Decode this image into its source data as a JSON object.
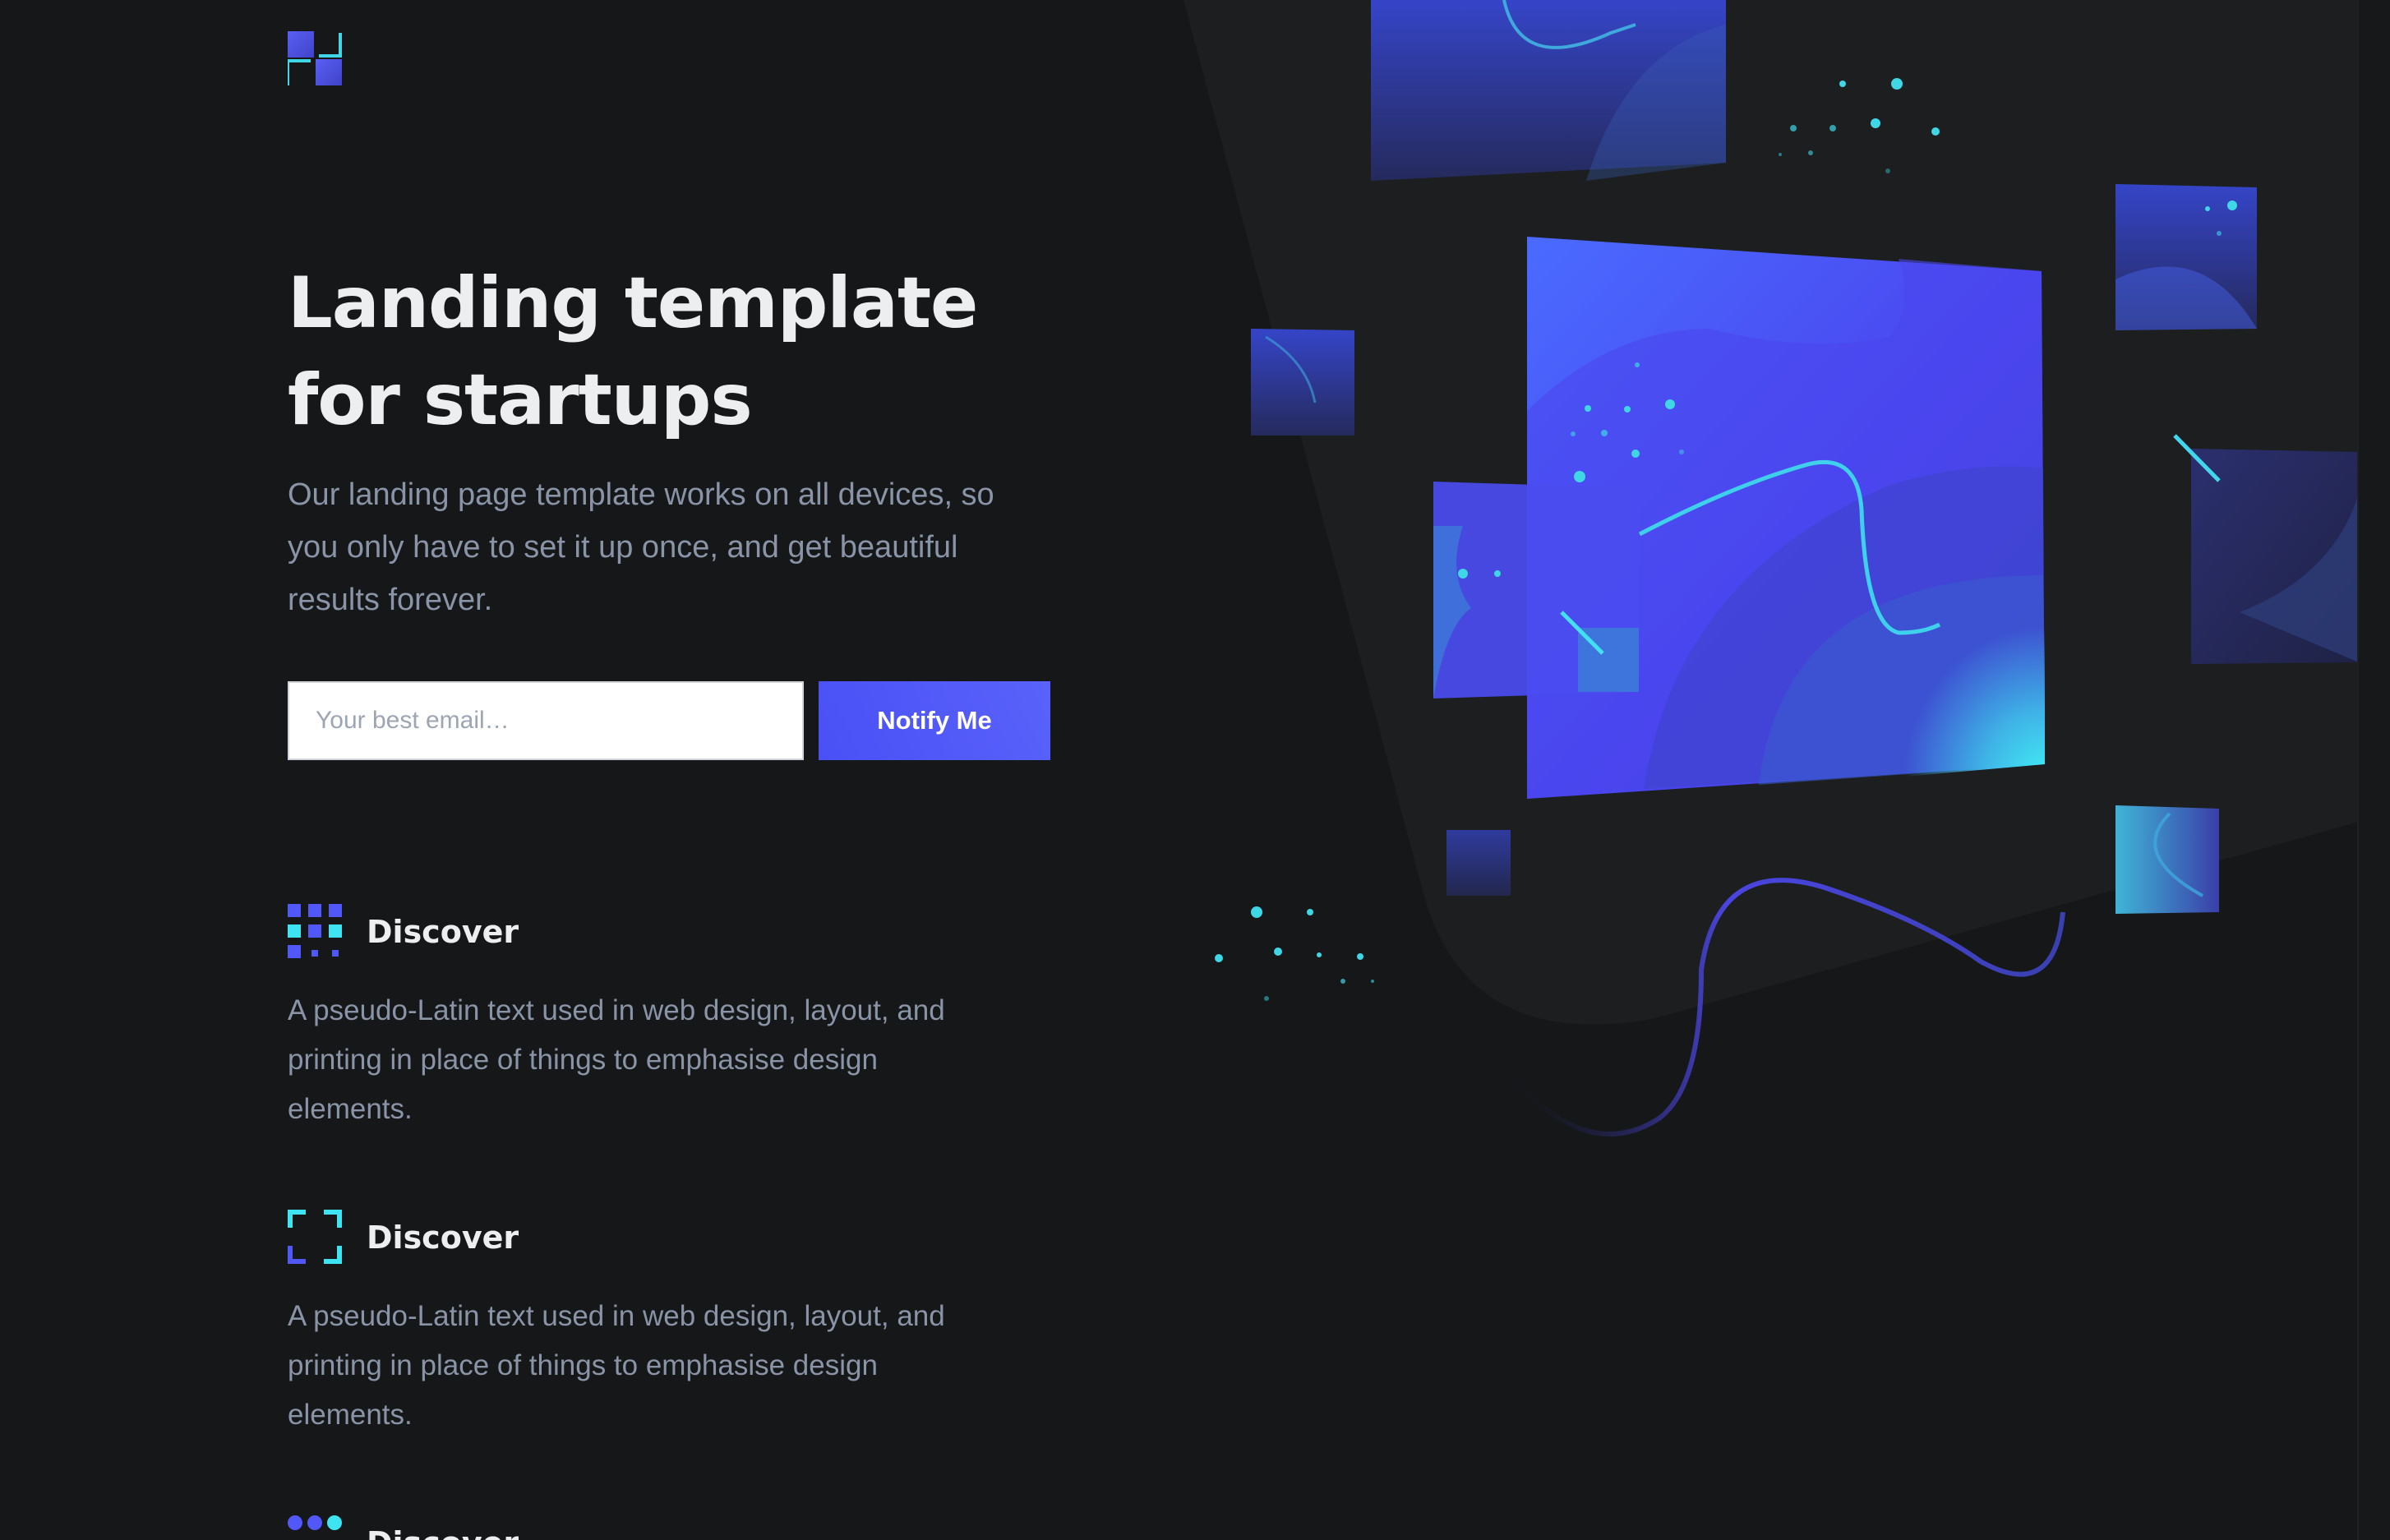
{
  "colors": {
    "background": "#151719",
    "heading": "#eceef0",
    "body_text": "#8a94a7",
    "primary": "#5158f7",
    "secondary": "#3fe4f2"
  },
  "header": {
    "logo_icon": "logo-mark-icon"
  },
  "hero": {
    "title": "Landing template for startups",
    "paragraph": "Our landing page template works on all devices, so you only have to set it up once, and get beautiful results forever.",
    "email_placeholder": "Your best email…",
    "email_value": "",
    "notify_label": "Notify Me"
  },
  "features": [
    {
      "icon": "grid-dots-icon",
      "title": "Discover",
      "text": "A pseudo-Latin text used in web design, layout, and printing in place of things to emphasise design elements."
    },
    {
      "icon": "frame-corners-icon",
      "title": "Discover",
      "text": "A pseudo-Latin text used in web design, layout, and printing in place of things to emphasise design elements."
    },
    {
      "icon": "circle-dots-icon",
      "title": "Discover",
      "text": ""
    }
  ],
  "illustration": {
    "icon": "abstract-cards-illustration"
  }
}
